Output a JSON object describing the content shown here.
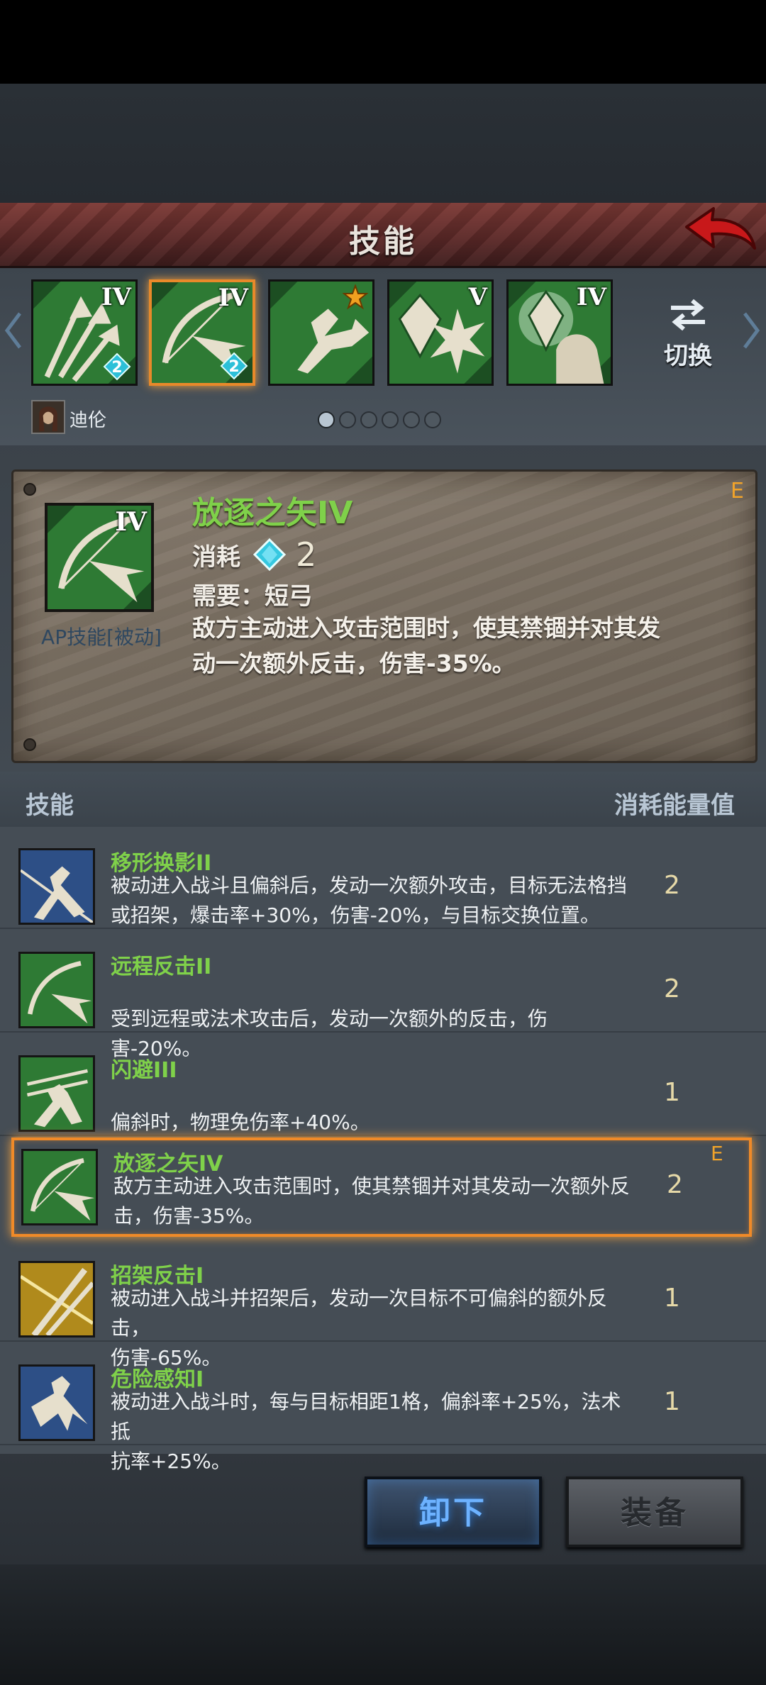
{
  "header": {
    "title": "技能"
  },
  "strip": {
    "slots": [
      {
        "rank": "IV",
        "gem": "2",
        "icon": "arrows-icon"
      },
      {
        "rank": "IV",
        "gem": "2",
        "icon": "bow-arrow-icon",
        "selected": true
      },
      {
        "rank": "",
        "gem": "",
        "icon": "parry-arrow-icon",
        "starred": true
      },
      {
        "rank": "V",
        "gem": "",
        "icon": "crystal-burst-icon"
      },
      {
        "rank": "IV",
        "gem": "",
        "icon": "crystal-hand-icon"
      }
    ],
    "swap_label": "切换",
    "character_name": "迪伦",
    "page_count": 6,
    "active_page": 1
  },
  "detail": {
    "name": "放逐之矢IV",
    "rank": "IV",
    "grade": "E",
    "type": "AP技能[被动]",
    "cost_label": "消耗",
    "cost_value": "2",
    "require": "需要：短弓",
    "description_line1": "敌方主动进入攻击范围时，使其禁锢并对其发",
    "description_line2": "动一次额外反击，伤害-35%。"
  },
  "list": {
    "header_left": "技能",
    "header_right": "消耗能量值",
    "items": [
      {
        "name": "移形换影II",
        "desc1": "被动进入战斗且偏斜后，发动一次额外攻击，目标无法格挡",
        "desc2": "或招架，爆击率+30%，伤害-20%，与目标交换位置。",
        "cost": "2",
        "grade": "",
        "color": "#2d4f86"
      },
      {
        "name": "远程反击II",
        "desc1": "",
        "desc2": "受到远程或法术攻击后，发动一次额外的反击，伤害-20%。",
        "cost": "2",
        "grade": "",
        "color": "#2c6f33"
      },
      {
        "name": "闪避III",
        "desc1": "",
        "desc2": "偏斜时，物理免伤率+40%。",
        "cost": "1",
        "grade": "",
        "color": "#2c6f33"
      },
      {
        "name": "放逐之矢IV",
        "desc1": "敌方主动进入攻击范围时，使其禁锢并对其发动一次额外反",
        "desc2": "击，伤害-35%。",
        "cost": "2",
        "grade": "E",
        "color": "#2c6f33"
      },
      {
        "name": "招架反击I",
        "desc1": "被动进入战斗并招架后，发动一次目标不可偏斜的额外反击，",
        "desc2": "伤害-65%。",
        "cost": "1",
        "grade": "",
        "color": "#b08a1c"
      },
      {
        "name": "危险感知I",
        "desc1": "被动进入战斗时，每与目标相距1格，偏斜率+25%，法术抵",
        "desc2": "抗率+25%。",
        "cost": "1",
        "grade": "",
        "color": "#2d4f86"
      }
    ]
  },
  "buttons": {
    "unequip": "卸下",
    "equip": "装备"
  }
}
